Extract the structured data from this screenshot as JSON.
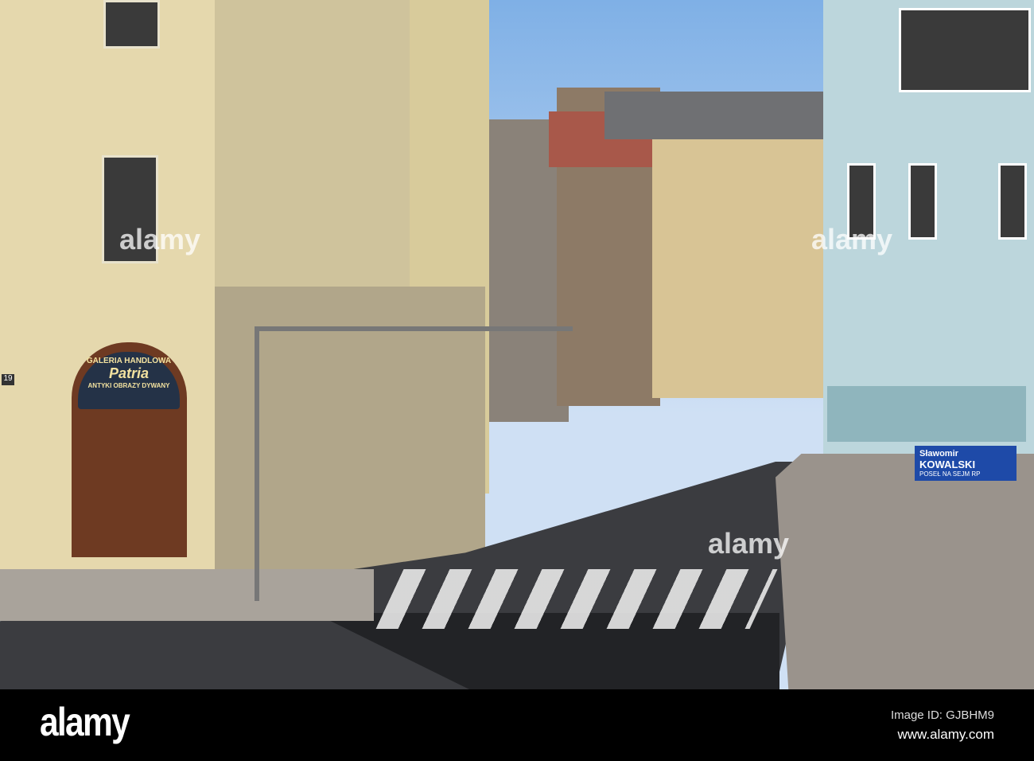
{
  "photo": {
    "shop_sign": {
      "line1": "GALERIA HANDLOWA",
      "line2": "Patria",
      "line3": "ANTYKI OBRAZY DYWANY"
    },
    "house_number": "19",
    "campaign_sign": {
      "name": "Sławomir",
      "surname": "KOWALSKI",
      "subtitle": "POSEŁ NA SEJM RP"
    },
    "watermark": "alamy"
  },
  "footer": {
    "logo": "alamy",
    "image_id": "Image ID: GJBHM9",
    "url": "www.alamy.com"
  }
}
